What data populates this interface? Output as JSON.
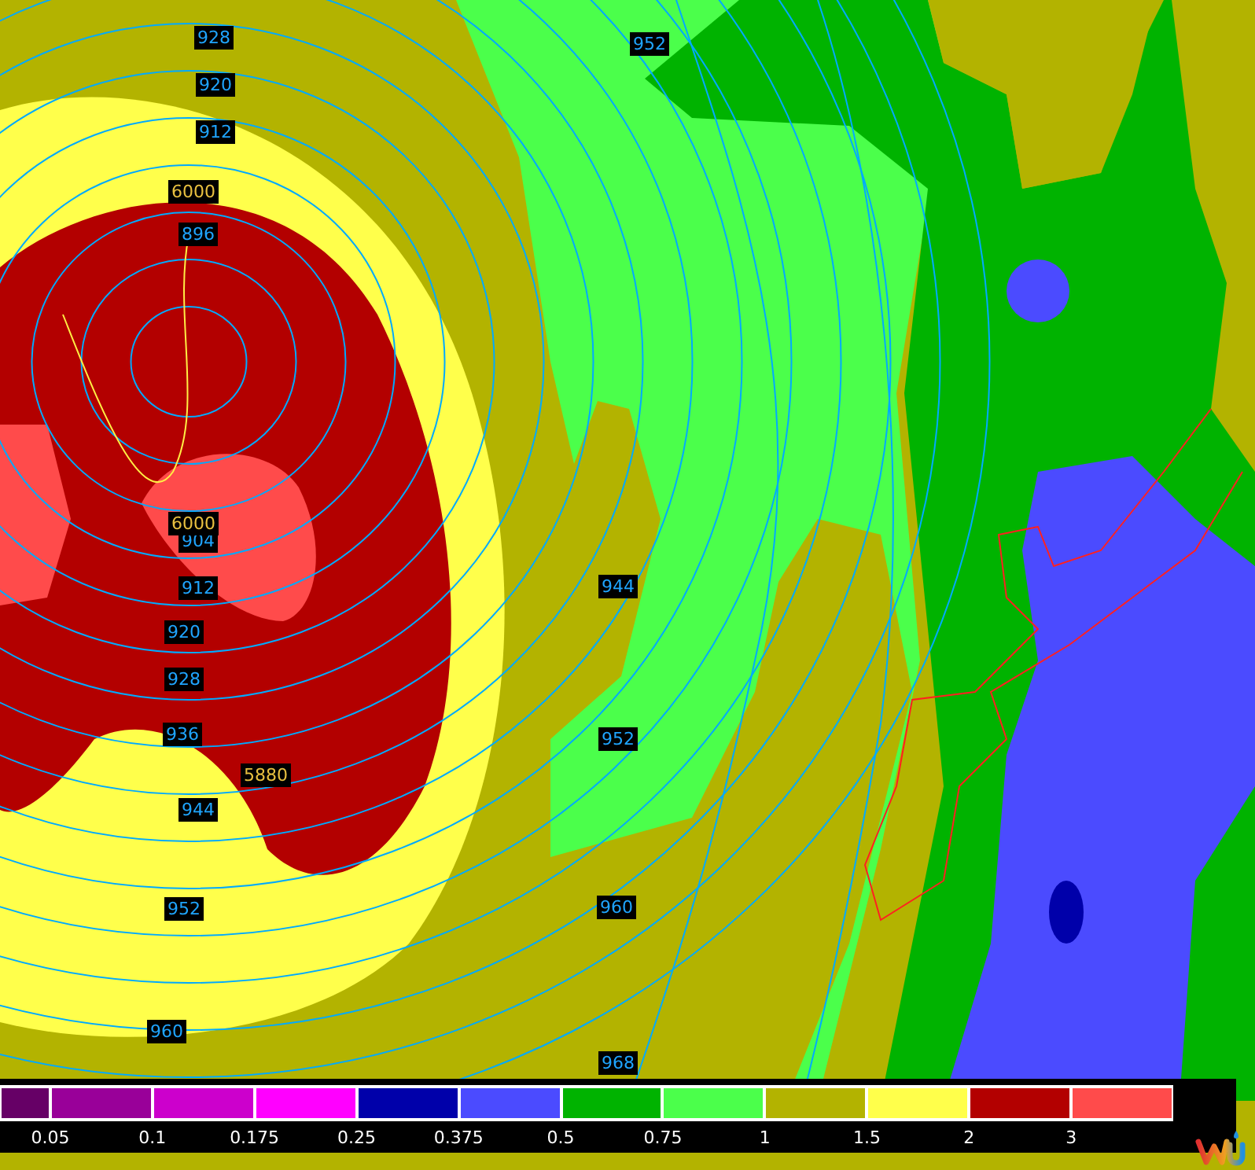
{
  "map": {
    "pressure_labels": [
      {
        "text": "928"
      },
      {
        "text": "952"
      },
      {
        "text": "920"
      },
      {
        "text": "912"
      },
      {
        "text": "896"
      },
      {
        "text": "904"
      },
      {
        "text": "912"
      },
      {
        "text": "944"
      },
      {
        "text": "920"
      },
      {
        "text": "928"
      },
      {
        "text": "936"
      },
      {
        "text": "952"
      },
      {
        "text": "944"
      },
      {
        "text": "952"
      },
      {
        "text": "960"
      },
      {
        "text": "960"
      },
      {
        "text": "968"
      }
    ],
    "height_labels": [
      {
        "text": "6000"
      },
      {
        "text": "6000"
      },
      {
        "text": "5880"
      }
    ]
  },
  "legend": {
    "swatches": [
      {
        "color": "#660066"
      },
      {
        "color": "#990099"
      },
      {
        "color": "#cc00cc"
      },
      {
        "color": "#ff00ff"
      },
      {
        "color": "#0000aa"
      },
      {
        "color": "#4b4bff"
      },
      {
        "color": "#00b300"
      },
      {
        "color": "#4bff4b"
      },
      {
        "color": "#b3b300"
      },
      {
        "color": "#ffff4b"
      },
      {
        "color": "#b30000"
      },
      {
        "color": "#ff4b4b"
      }
    ],
    "ticks": [
      "0.05",
      "0.1",
      "0.175",
      "0.25",
      "0.375",
      "0.5",
      "0.75",
      "1",
      "1.5",
      "2",
      "3"
    ]
  }
}
